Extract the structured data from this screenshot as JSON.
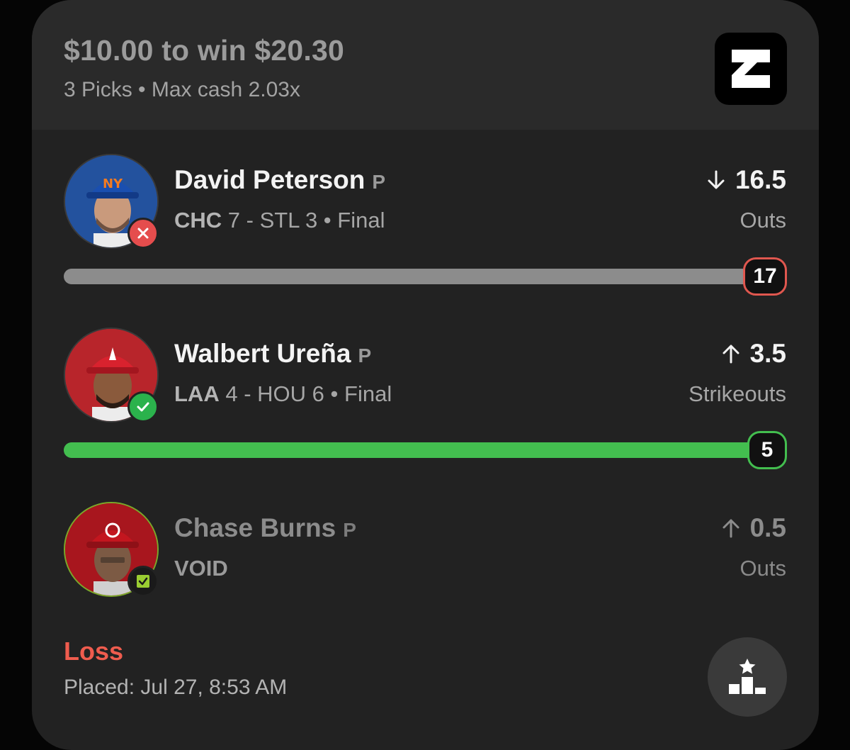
{
  "entry": {
    "title": "$10.00 to win $20.30",
    "subtitle": "3 Picks • Max cash 2.03x"
  },
  "picks": [
    {
      "player": "David Peterson",
      "position": "P",
      "team1": "CHC",
      "score1": "7",
      "team2": "STL",
      "score2": "3",
      "status": "Final",
      "direction": "down",
      "line": "16.5",
      "stat": "Outs",
      "result_value": "17",
      "outcome": "loss",
      "cap_color": "#1f4ea8"
    },
    {
      "player": "Walbert Ureña",
      "position": "P",
      "team1": "LAA",
      "score1": "4",
      "team2": "HOU",
      "score2": "6",
      "status": "Final",
      "direction": "up",
      "line": "3.5",
      "stat": "Strikeouts",
      "result_value": "5",
      "outcome": "win",
      "cap_color": "#c8202c"
    },
    {
      "player": "Chase Burns",
      "position": "P",
      "game_text": "VOID",
      "direction": "up",
      "line": "0.5",
      "stat": "Outs",
      "outcome": "void",
      "cap_color": "#b5171f"
    }
  ],
  "footer": {
    "result": "Loss",
    "placed": "Placed: Jul 27, 8:53 AM"
  },
  "colors": {
    "loss": "#ef5c4e",
    "win": "#43be4f",
    "void": "#9acd32"
  }
}
